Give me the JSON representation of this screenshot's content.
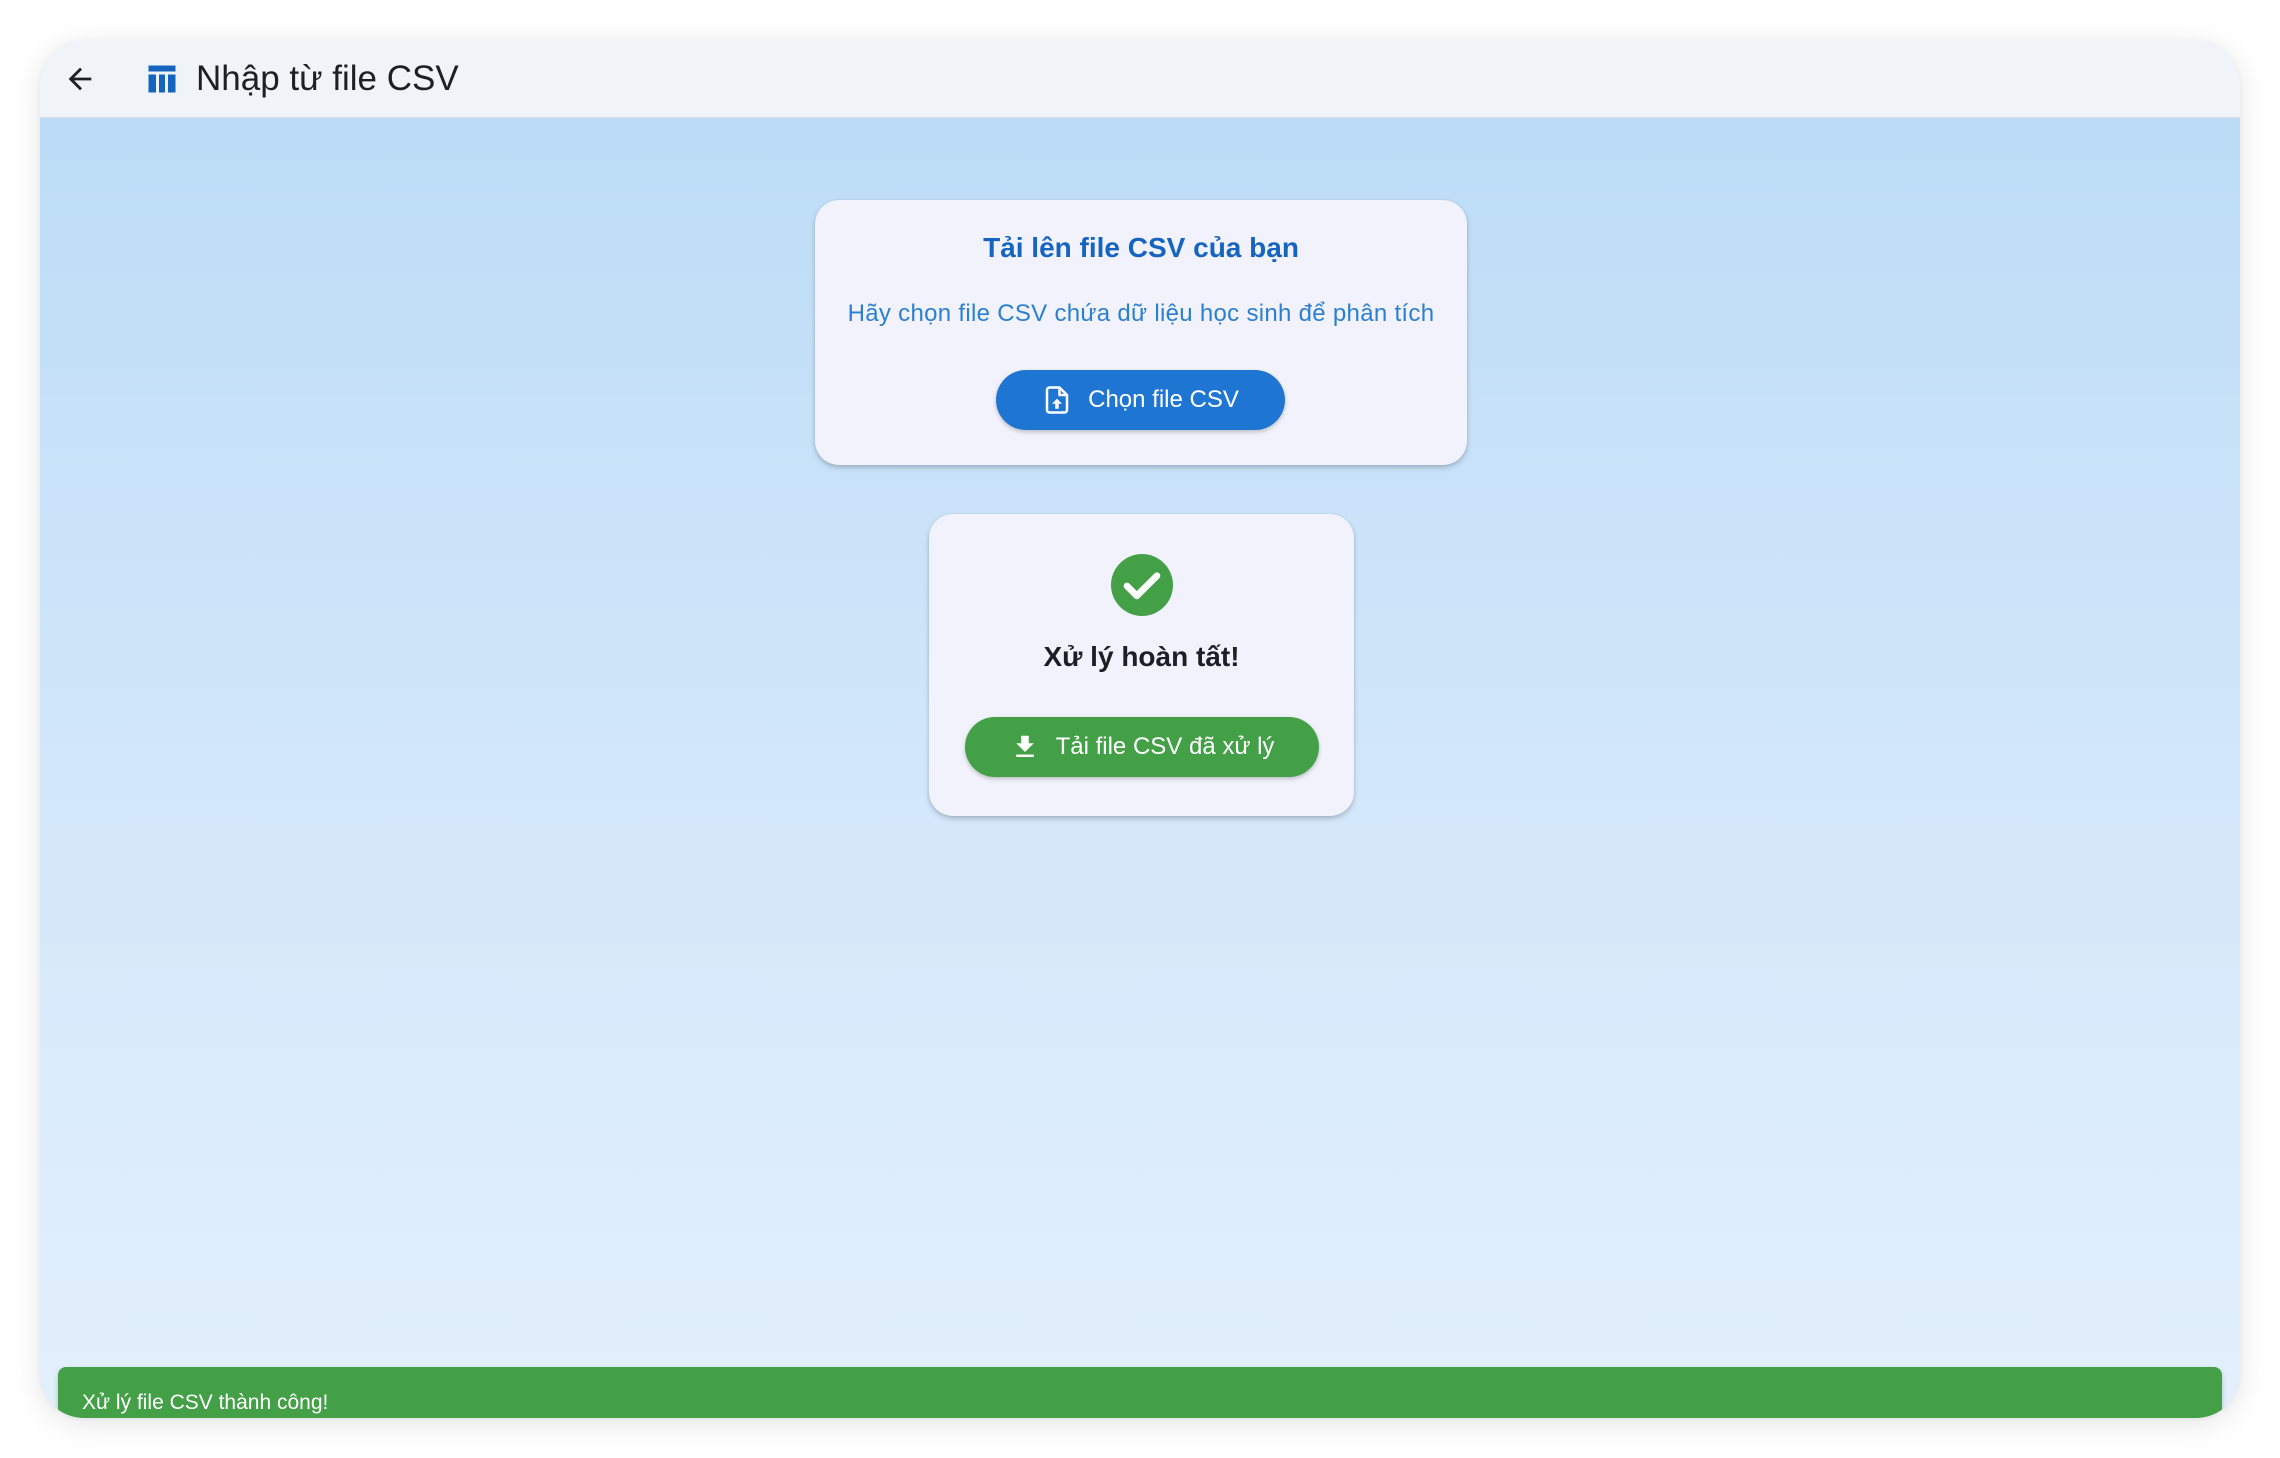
{
  "appbar": {
    "back_icon": "arrow-back-icon",
    "title_icon": "table-icon",
    "title": "Nhập từ file CSV"
  },
  "upload_card": {
    "title": "Tải lên file CSV của bạn",
    "subtitle": "Hãy chọn file CSV chứa dữ liệu học sinh để phân tích",
    "button_icon": "file-upload-icon",
    "button_label": "Chọn file CSV"
  },
  "result_card": {
    "status_icon": "check-circle-icon",
    "title": "Xử lý hoàn tất!",
    "button_icon": "download-icon",
    "button_label": "Tải file CSV đã xử lý"
  },
  "snackbar": {
    "message": "Xử lý file CSV thành công!"
  },
  "colors": {
    "primary": "#1f76d2",
    "primary_text": "#1565c0",
    "success": "#43a047",
    "card_bg": "#f1f2fb",
    "background_top": "#bcdcf7",
    "background_bottom": "#e3f0fc"
  }
}
